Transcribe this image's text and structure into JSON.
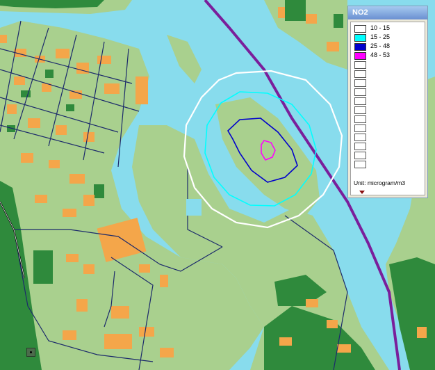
{
  "legend": {
    "title": "NO2",
    "items": [
      {
        "range": "10 - 15",
        "color": "#ffffff"
      },
      {
        "range": "15 - 25",
        "color": "#00ffff"
      },
      {
        "range": "25 - 48",
        "color": "#0000cc"
      },
      {
        "range": "48 - 53",
        "color": "#ff00ff"
      }
    ],
    "empty_slot_count": 12,
    "unit": "Unit: microgram/m3"
  },
  "colors": {
    "water": "#88dced",
    "land_light": "#a9d08e",
    "forest": "#2f8a3c",
    "buildings": "#f4a64a",
    "roads": "#1c2a6b",
    "river_boundary": "#7a1f9b",
    "contour_10_15": "#ffffff",
    "contour_15_25": "#00ffff",
    "contour_25_48": "#0000cc",
    "contour_48_53": "#ff00ff"
  }
}
